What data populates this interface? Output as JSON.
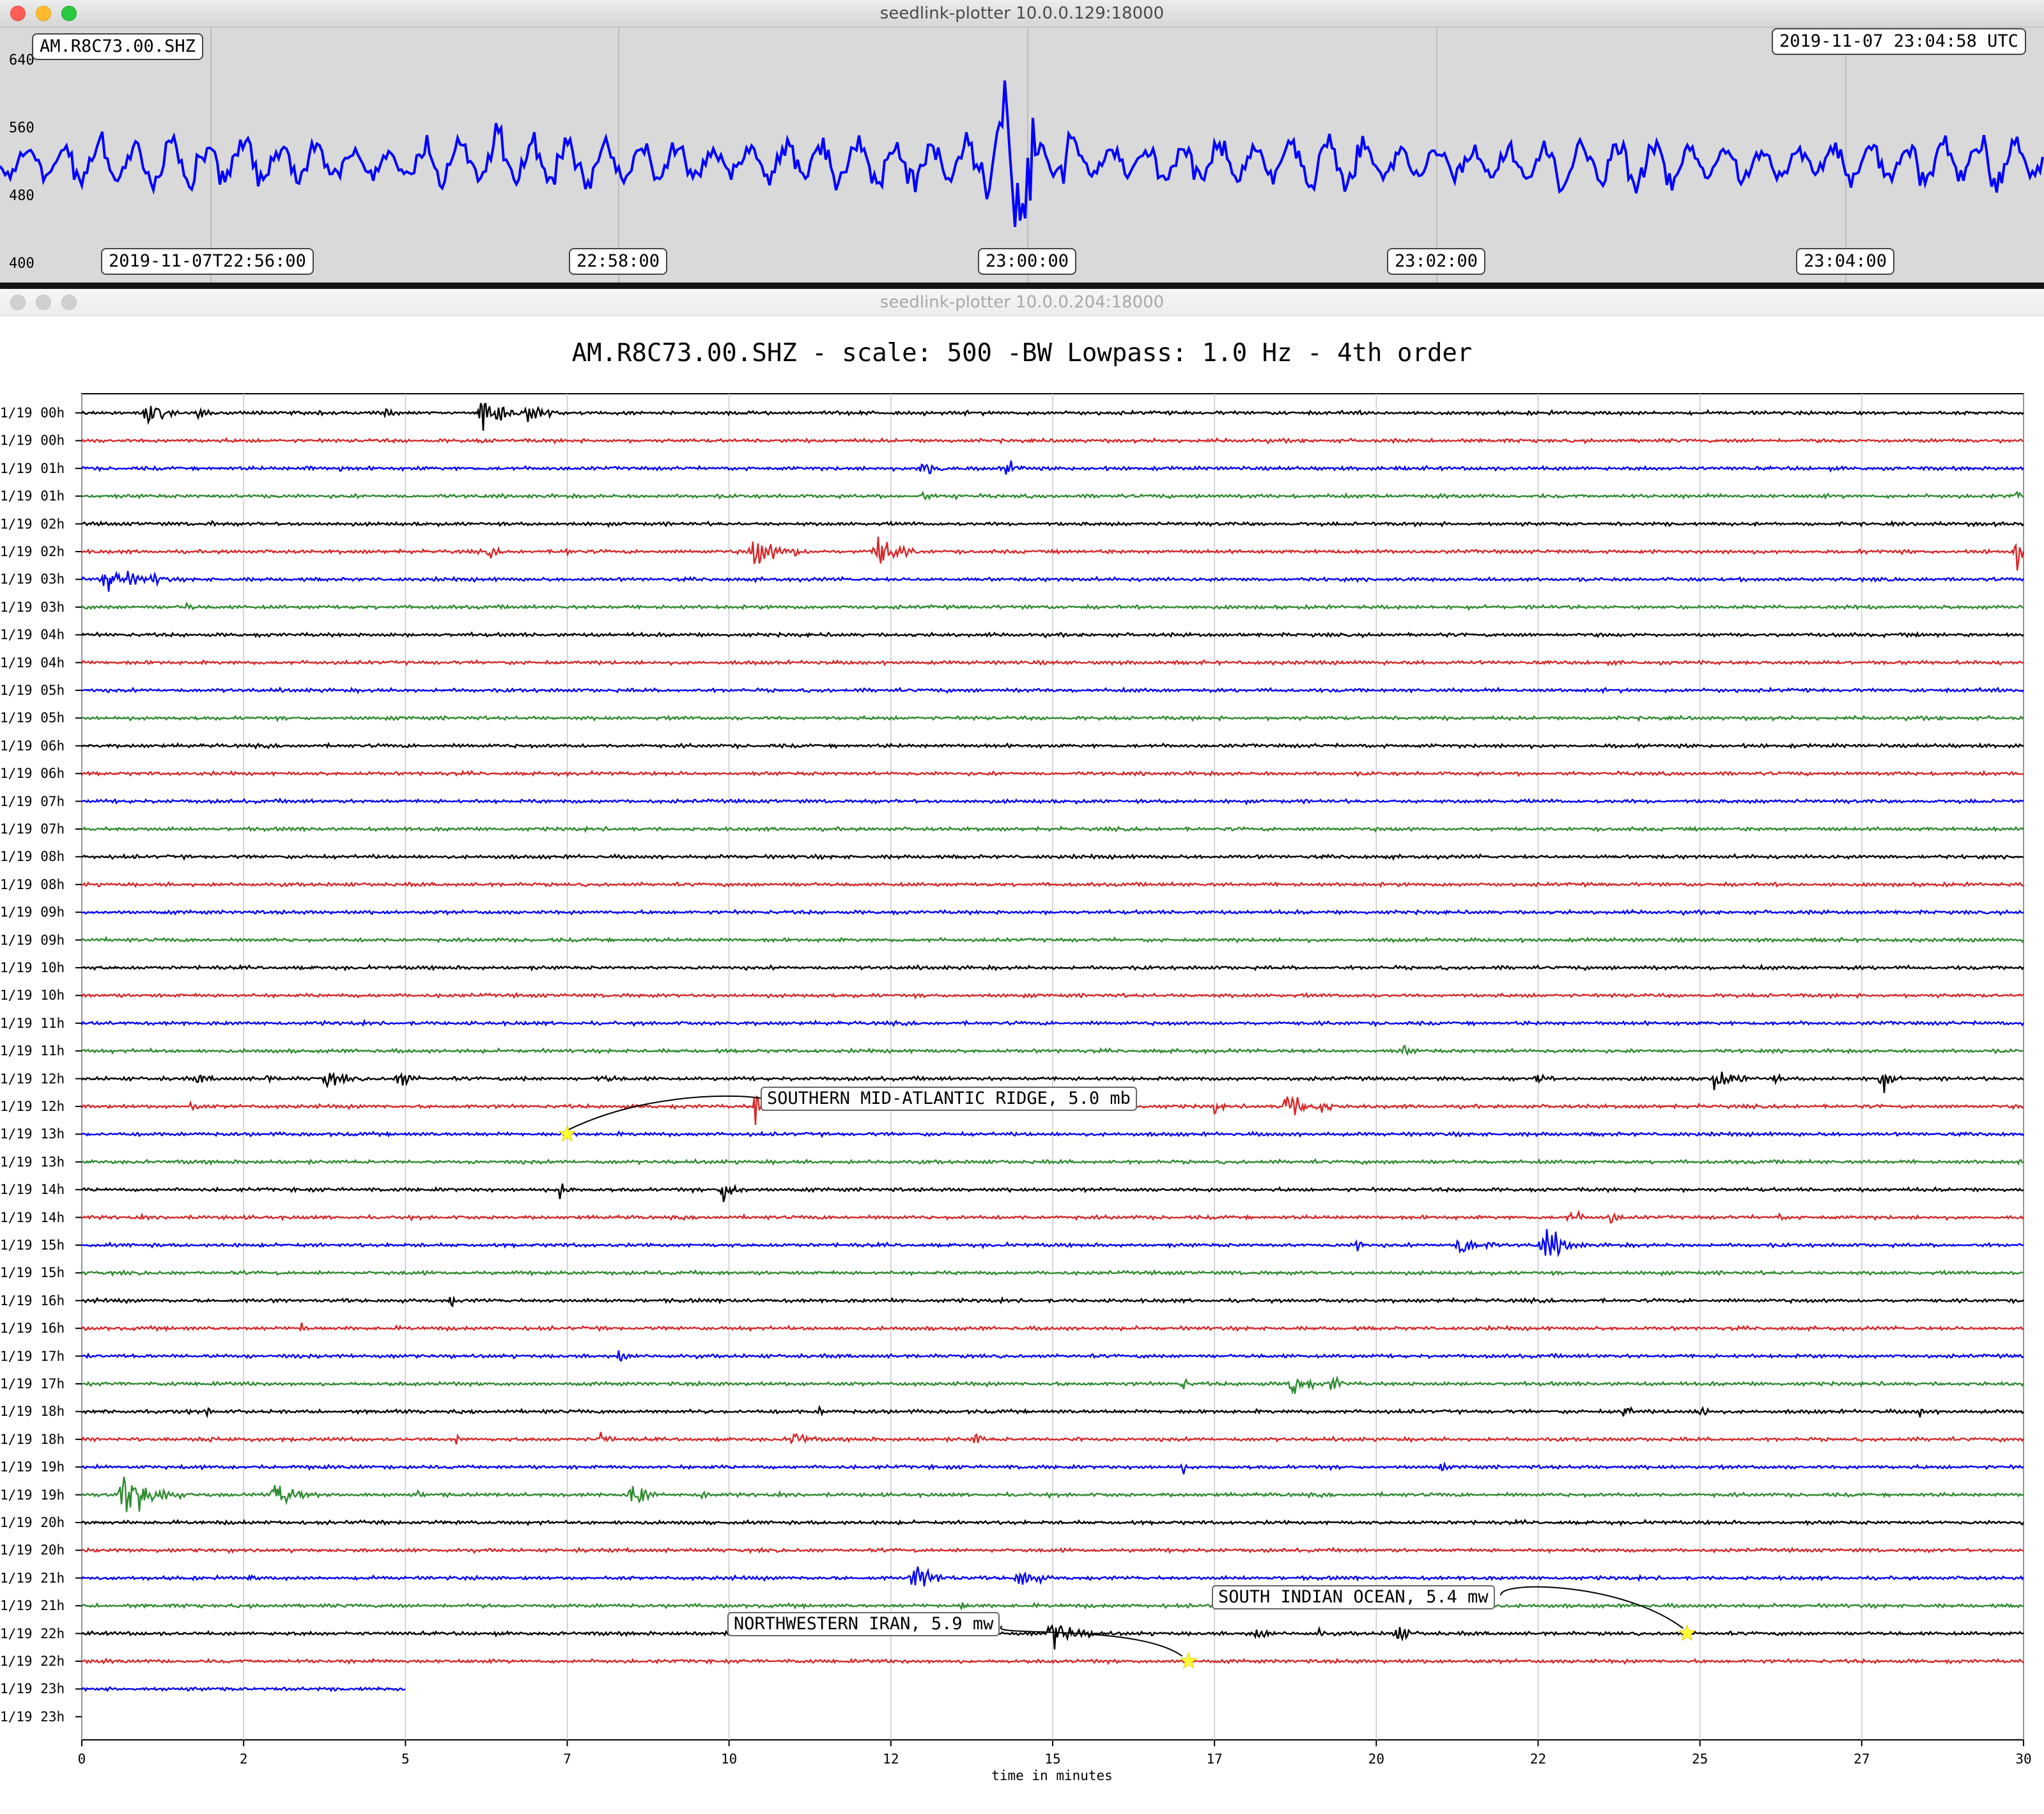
{
  "overview_window": {
    "title": "seedlink-plotter 10.0.0.129:18000",
    "channel_label": "AM.R8C73.00.SHZ",
    "timestamp": "2019-11-07 23:04:58 UTC",
    "y_ticks": [
      "640",
      "560",
      "480",
      "400"
    ],
    "x_ticks": [
      "2019-11-07T22:56:00",
      "22:58:00",
      "23:00:00",
      "23:02:00",
      "23:04:00"
    ],
    "trace_color": "#0000ff",
    "background_color": "#d9d9d9"
  },
  "helicorder_window": {
    "title": "seedlink-plotter 10.0.0.204:18000"
  },
  "chart_data": {
    "type": "line",
    "title": "AM.R8C73.00.SHZ - scale: 500 -BW Lowpass: 1.0 Hz - 4th order",
    "xlabel": "time in minutes",
    "ylabel": "",
    "xlim": [
      0,
      30
    ],
    "x_ticks": [
      "0",
      "2",
      "5",
      "7",
      "10",
      "12",
      "15",
      "17",
      "20",
      "22",
      "25",
      "27",
      "30"
    ],
    "grid": true,
    "row_colors": [
      "#000000",
      "#d62728",
      "#0000ff",
      "#2e8b2e"
    ],
    "row_labels": [
      "1/19 00h",
      "1/19 00h",
      "1/19 01h",
      "1/19 01h",
      "1/19 02h",
      "1/19 02h",
      "1/19 03h",
      "1/19 03h",
      "1/19 04h",
      "1/19 04h",
      "1/19 05h",
      "1/19 05h",
      "1/19 06h",
      "1/19 06h",
      "1/19 07h",
      "1/19 07h",
      "1/19 08h",
      "1/19 08h",
      "1/19 09h",
      "1/19 09h",
      "1/19 10h",
      "1/19 10h",
      "1/19 11h",
      "1/19 11h",
      "1/19 12h",
      "1/19 12h",
      "1/19 13h",
      "1/19 13h",
      "1/19 14h",
      "1/19 14h",
      "1/19 15h",
      "1/19 15h",
      "1/19 16h",
      "1/19 16h",
      "1/19 17h",
      "1/19 17h",
      "1/19 18h",
      "1/19 18h",
      "1/19 19h",
      "1/19 19h",
      "1/19 20h",
      "1/19 20h",
      "1/19 21h",
      "1/19 21h",
      "1/19 22h",
      "1/19 22h",
      "1/19 23h",
      "1/19 23h"
    ],
    "last_trace_end_minute": 5,
    "events": [
      {
        "label": "SOUTHERN MID-ATLANTIC RIDGE, 5.0 mb",
        "row": 26,
        "minute": 7.5
      },
      {
        "label": "NORTHWESTERN IRAN, 5.9 mw",
        "row": 45,
        "minute": 17.1
      },
      {
        "label": "SOUTH INDIAN OCEAN, 5.4 mw",
        "row": 44,
        "minute": 24.8
      }
    ],
    "event_marker_color": "#ffff33"
  }
}
